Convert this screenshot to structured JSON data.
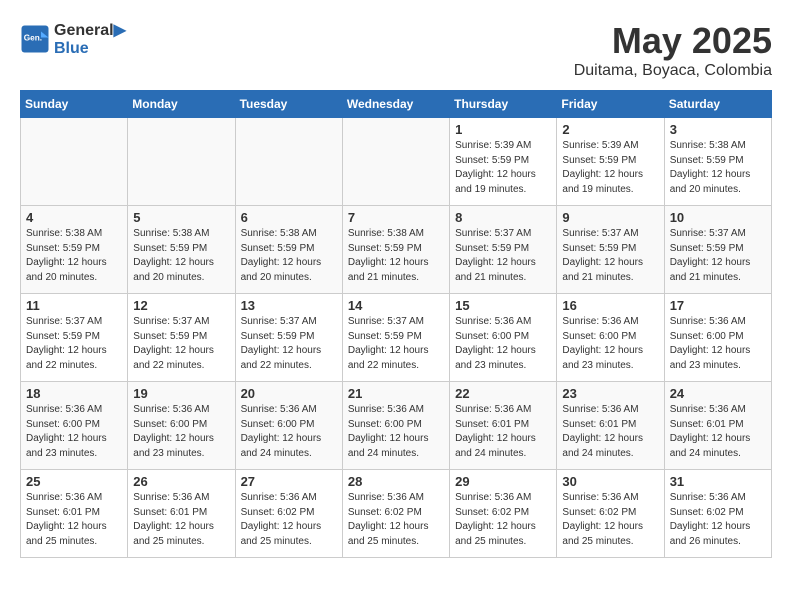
{
  "header": {
    "logo_line1": "General",
    "logo_line2": "Blue",
    "month_year": "May 2025",
    "location": "Duitama, Boyaca, Colombia"
  },
  "weekdays": [
    "Sunday",
    "Monday",
    "Tuesday",
    "Wednesday",
    "Thursday",
    "Friday",
    "Saturday"
  ],
  "weeks": [
    [
      {
        "num": "",
        "info": ""
      },
      {
        "num": "",
        "info": ""
      },
      {
        "num": "",
        "info": ""
      },
      {
        "num": "",
        "info": ""
      },
      {
        "num": "1",
        "info": "Sunrise: 5:39 AM\nSunset: 5:59 PM\nDaylight: 12 hours\nand 19 minutes."
      },
      {
        "num": "2",
        "info": "Sunrise: 5:39 AM\nSunset: 5:59 PM\nDaylight: 12 hours\nand 19 minutes."
      },
      {
        "num": "3",
        "info": "Sunrise: 5:38 AM\nSunset: 5:59 PM\nDaylight: 12 hours\nand 20 minutes."
      }
    ],
    [
      {
        "num": "4",
        "info": "Sunrise: 5:38 AM\nSunset: 5:59 PM\nDaylight: 12 hours\nand 20 minutes."
      },
      {
        "num": "5",
        "info": "Sunrise: 5:38 AM\nSunset: 5:59 PM\nDaylight: 12 hours\nand 20 minutes."
      },
      {
        "num": "6",
        "info": "Sunrise: 5:38 AM\nSunset: 5:59 PM\nDaylight: 12 hours\nand 20 minutes."
      },
      {
        "num": "7",
        "info": "Sunrise: 5:38 AM\nSunset: 5:59 PM\nDaylight: 12 hours\nand 21 minutes."
      },
      {
        "num": "8",
        "info": "Sunrise: 5:37 AM\nSunset: 5:59 PM\nDaylight: 12 hours\nand 21 minutes."
      },
      {
        "num": "9",
        "info": "Sunrise: 5:37 AM\nSunset: 5:59 PM\nDaylight: 12 hours\nand 21 minutes."
      },
      {
        "num": "10",
        "info": "Sunrise: 5:37 AM\nSunset: 5:59 PM\nDaylight: 12 hours\nand 21 minutes."
      }
    ],
    [
      {
        "num": "11",
        "info": "Sunrise: 5:37 AM\nSunset: 5:59 PM\nDaylight: 12 hours\nand 22 minutes."
      },
      {
        "num": "12",
        "info": "Sunrise: 5:37 AM\nSunset: 5:59 PM\nDaylight: 12 hours\nand 22 minutes."
      },
      {
        "num": "13",
        "info": "Sunrise: 5:37 AM\nSunset: 5:59 PM\nDaylight: 12 hours\nand 22 minutes."
      },
      {
        "num": "14",
        "info": "Sunrise: 5:37 AM\nSunset: 5:59 PM\nDaylight: 12 hours\nand 22 minutes."
      },
      {
        "num": "15",
        "info": "Sunrise: 5:36 AM\nSunset: 6:00 PM\nDaylight: 12 hours\nand 23 minutes."
      },
      {
        "num": "16",
        "info": "Sunrise: 5:36 AM\nSunset: 6:00 PM\nDaylight: 12 hours\nand 23 minutes."
      },
      {
        "num": "17",
        "info": "Sunrise: 5:36 AM\nSunset: 6:00 PM\nDaylight: 12 hours\nand 23 minutes."
      }
    ],
    [
      {
        "num": "18",
        "info": "Sunrise: 5:36 AM\nSunset: 6:00 PM\nDaylight: 12 hours\nand 23 minutes."
      },
      {
        "num": "19",
        "info": "Sunrise: 5:36 AM\nSunset: 6:00 PM\nDaylight: 12 hours\nand 23 minutes."
      },
      {
        "num": "20",
        "info": "Sunrise: 5:36 AM\nSunset: 6:00 PM\nDaylight: 12 hours\nand 24 minutes."
      },
      {
        "num": "21",
        "info": "Sunrise: 5:36 AM\nSunset: 6:00 PM\nDaylight: 12 hours\nand 24 minutes."
      },
      {
        "num": "22",
        "info": "Sunrise: 5:36 AM\nSunset: 6:01 PM\nDaylight: 12 hours\nand 24 minutes."
      },
      {
        "num": "23",
        "info": "Sunrise: 5:36 AM\nSunset: 6:01 PM\nDaylight: 12 hours\nand 24 minutes."
      },
      {
        "num": "24",
        "info": "Sunrise: 5:36 AM\nSunset: 6:01 PM\nDaylight: 12 hours\nand 24 minutes."
      }
    ],
    [
      {
        "num": "25",
        "info": "Sunrise: 5:36 AM\nSunset: 6:01 PM\nDaylight: 12 hours\nand 25 minutes."
      },
      {
        "num": "26",
        "info": "Sunrise: 5:36 AM\nSunset: 6:01 PM\nDaylight: 12 hours\nand 25 minutes."
      },
      {
        "num": "27",
        "info": "Sunrise: 5:36 AM\nSunset: 6:02 PM\nDaylight: 12 hours\nand 25 minutes."
      },
      {
        "num": "28",
        "info": "Sunrise: 5:36 AM\nSunset: 6:02 PM\nDaylight: 12 hours\nand 25 minutes."
      },
      {
        "num": "29",
        "info": "Sunrise: 5:36 AM\nSunset: 6:02 PM\nDaylight: 12 hours\nand 25 minutes."
      },
      {
        "num": "30",
        "info": "Sunrise: 5:36 AM\nSunset: 6:02 PM\nDaylight: 12 hours\nand 25 minutes."
      },
      {
        "num": "31",
        "info": "Sunrise: 5:36 AM\nSunset: 6:02 PM\nDaylight: 12 hours\nand 26 minutes."
      }
    ]
  ]
}
